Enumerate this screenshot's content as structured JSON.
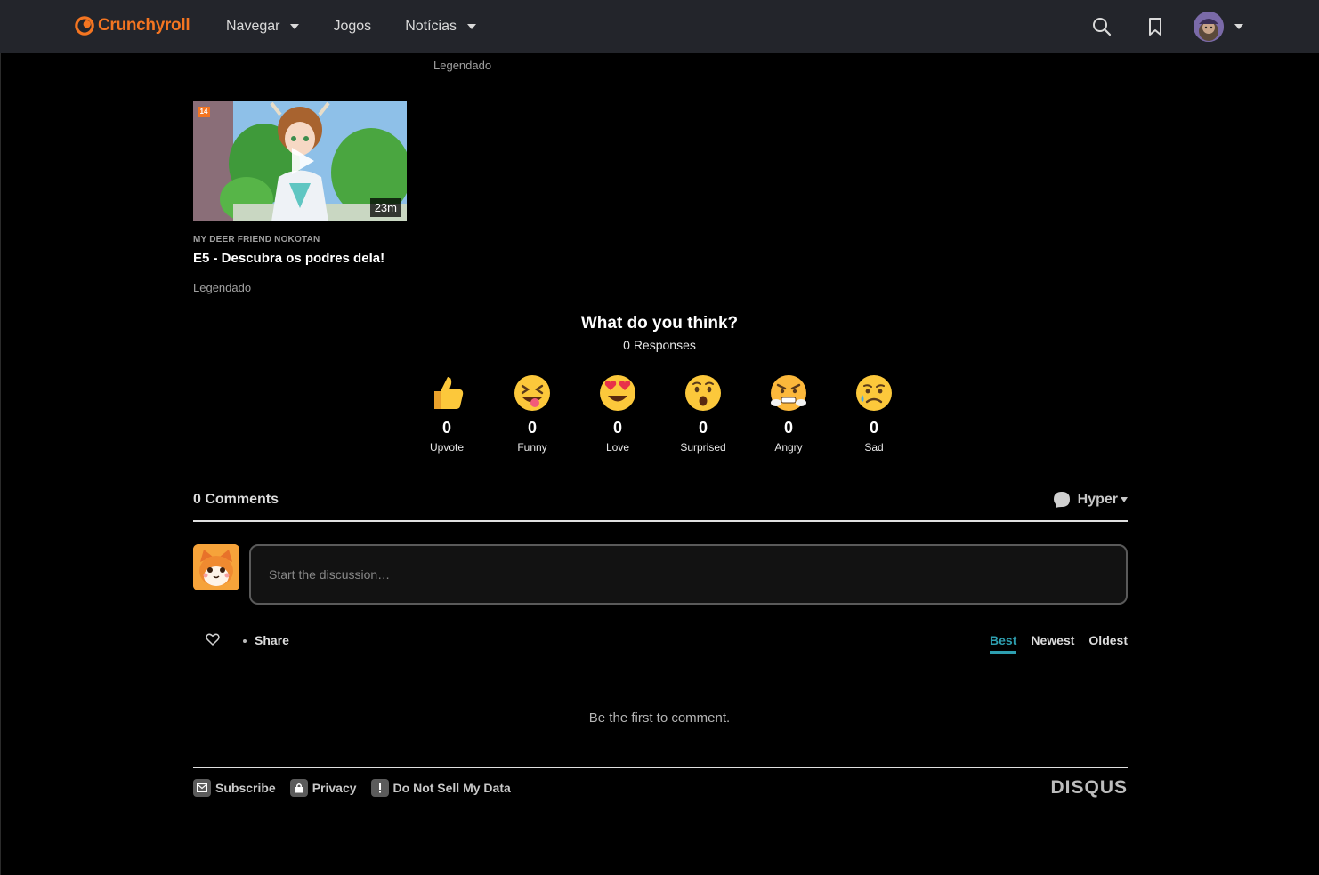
{
  "header": {
    "logo_text": "Crunchyroll",
    "nav": [
      {
        "label": "Navegar",
        "has_dropdown": true
      },
      {
        "label": "Jogos",
        "has_dropdown": false
      },
      {
        "label": "Notícias",
        "has_dropdown": true
      }
    ],
    "icons": [
      "search-icon",
      "bookmark-icon",
      "avatar"
    ],
    "brand_color": "#f47521"
  },
  "episodes": {
    "prev_meta": "Legendado",
    "card": {
      "age_badge": "14",
      "duration": "23m",
      "series": "MY DEER FRIEND NOKOTAN",
      "title": "E5 - Descubra os podres dela!",
      "meta": "Legendado"
    }
  },
  "reactions": {
    "title": "What do you think?",
    "responses": "0 Responses",
    "items": [
      {
        "label": "Upvote",
        "count": "0",
        "icon": "thumbs-up-icon"
      },
      {
        "label": "Funny",
        "count": "0",
        "icon": "funny-face-icon"
      },
      {
        "label": "Love",
        "count": "0",
        "icon": "heart-eyes-icon"
      },
      {
        "label": "Surprised",
        "count": "0",
        "icon": "surprised-face-icon"
      },
      {
        "label": "Angry",
        "count": "0",
        "icon": "angry-face-icon"
      },
      {
        "label": "Sad",
        "count": "0",
        "icon": "sad-face-icon"
      }
    ]
  },
  "comments": {
    "count_label": "0 Comments",
    "user_name": "Hyper",
    "input_placeholder": "Start the discussion…",
    "share_label": "Share",
    "sort": [
      "Best",
      "Newest",
      "Oldest"
    ],
    "active_sort": "Best",
    "empty_message": "Be the first to comment.",
    "accent_color": "#2e9fb0"
  },
  "footer": {
    "links": [
      {
        "label": "Subscribe",
        "icon": "mail-icon"
      },
      {
        "label": "Privacy",
        "icon": "lock-icon"
      },
      {
        "label": "Do Not Sell My Data",
        "icon": "alert-icon"
      }
    ],
    "brand": "DISQUS"
  }
}
